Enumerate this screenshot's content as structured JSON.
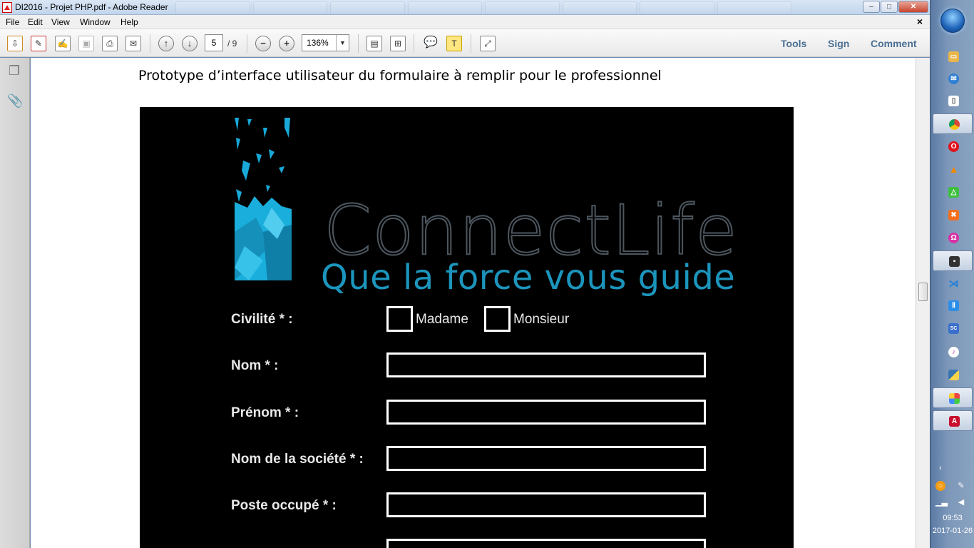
{
  "window": {
    "title": "DI2016 - Projet PHP.pdf - Adobe Reader",
    "min_label": "–",
    "max_label": "□",
    "close_label": "✕"
  },
  "menu": {
    "items": [
      "File",
      "Edit",
      "View",
      "Window",
      "Help"
    ],
    "doc_close": "×"
  },
  "toolbar": {
    "page_current": "5",
    "page_total": "/ 9",
    "zoom": "136%",
    "right_links": [
      "Tools",
      "Sign",
      "Comment"
    ]
  },
  "document": {
    "heading": "Prototype d’interface utilisateur du formulaire à remplir pour le professionnel",
    "logo": {
      "wordmark": "ConnectLife",
      "tagline": "Que la force vous guide"
    },
    "form": {
      "civility_label": "Civilité * :",
      "options": [
        "Madame",
        "Monsieur"
      ],
      "fields": [
        "Nom * :",
        "Prénom * :",
        "Nom de la société * :",
        "Poste occupé * :"
      ]
    }
  },
  "taskbar": {
    "clock_time": "09:53",
    "clock_date": "2017-01-26",
    "pinned_icons": [
      "folder-icon",
      "thunderbird-icon",
      "document-icon",
      "chrome-icon",
      "opera-icon",
      "vlc-icon",
      "android-icon",
      "xampp-icon",
      "app-icon",
      "terminal-icon",
      "vscode-icon",
      "notes-icon",
      "sc-icon",
      "itunes-icon",
      "python-icon",
      "shapes-icon",
      "acrobat-icon"
    ],
    "colors": {
      "accent": "#1c95bd",
      "link": "#4a6f93"
    }
  }
}
